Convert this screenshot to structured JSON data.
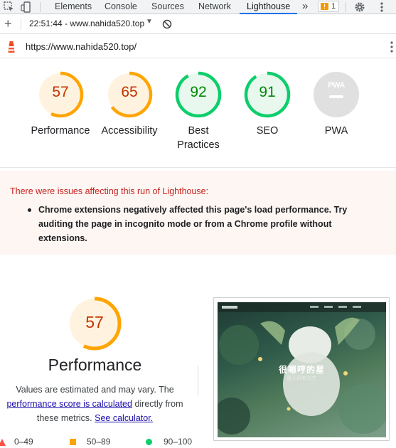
{
  "devtools": {
    "tabs": [
      "Elements",
      "Console",
      "Sources",
      "Network",
      "Lighthouse"
    ],
    "active_tab": "Lighthouse",
    "overflow": "»",
    "warning_count": "1"
  },
  "toolbar": {
    "report_label": "22:51:44 - www.nahida520.top",
    "caret": "▼"
  },
  "url": "https://www.nahida520.top/",
  "categories": [
    {
      "name": "Performance",
      "score": "57",
      "value": 57,
      "color": "#ffa400",
      "bg": "#fff3e0",
      "text": "#c33300"
    },
    {
      "name": "Accessibility",
      "score": "65",
      "value": 65,
      "color": "#ffa400",
      "bg": "#fff3e0",
      "text": "#c33300"
    },
    {
      "name": "Best Practices",
      "line1": "Best",
      "line2": "Practices",
      "score": "92",
      "value": 92,
      "color": "#0cce6b",
      "bg": "#e8f8ef",
      "text": "#008800"
    },
    {
      "name": "SEO",
      "score": "91",
      "value": 91,
      "color": "#0cce6b",
      "bg": "#e8f8ef",
      "text": "#008800"
    },
    {
      "name": "PWA",
      "badge": "PWA",
      "color": "#e0e0e0"
    }
  ],
  "runtime_warning": {
    "title": "There were issues affecting this run of Lighthouse:",
    "items": [
      "Chrome extensions negatively affected this page's load performance. Try auditing the page in incognito mode or from a Chrome profile without extensions."
    ]
  },
  "performance": {
    "score": "57",
    "value": 57,
    "title": "Performance",
    "desc_1": "Values are estimated and may vary. The",
    "desc_link": "performance score is calculated",
    "desc_2": " directly from",
    "desc_3": "these metrics.",
    "desc_link2": "See calculator."
  },
  "legend": [
    {
      "range": "0–49",
      "color": "#ff4e42",
      "shape": "triangle"
    },
    {
      "range": "50–89",
      "color": "#ffa400",
      "shape": "square"
    },
    {
      "range": "90–100",
      "color": "#0cce6b",
      "shape": "circle"
    }
  ],
  "screenshot": {
    "headline": "很嗯哼的星",
    "subline": "愿人间有光芒"
  }
}
